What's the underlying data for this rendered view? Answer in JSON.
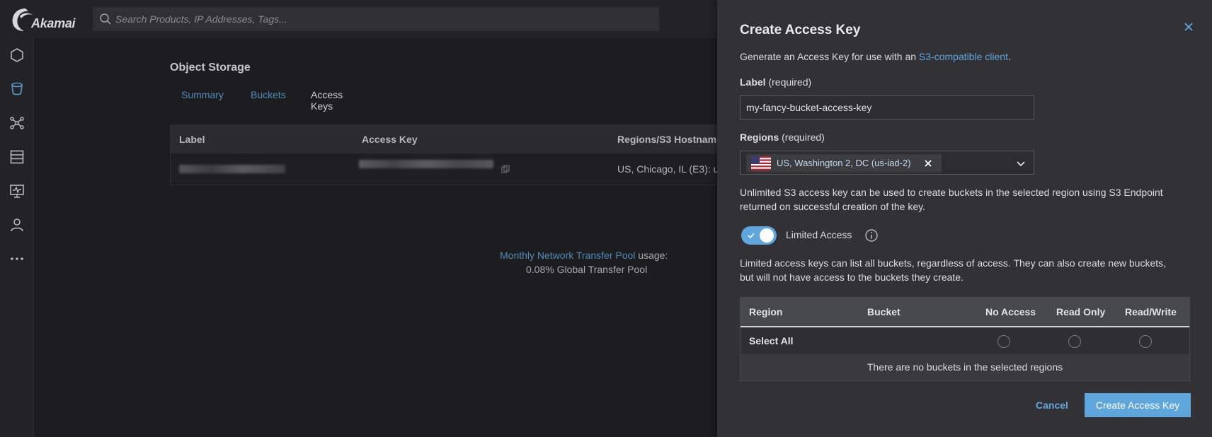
{
  "topbar": {
    "logo_text": "Akamai",
    "search_placeholder": "Search Products, IP Addresses, Tags..."
  },
  "sidebar": {
    "items": [
      "compute-icon",
      "object-storage-icon",
      "network-icon",
      "databases-icon",
      "monitor-icon",
      "account-icon",
      "more-icon"
    ]
  },
  "main": {
    "page_title": "Object Storage",
    "tabs": [
      {
        "label": "Summary"
      },
      {
        "label": "Buckets"
      },
      {
        "label": "Access Keys",
        "active": true
      }
    ],
    "table": {
      "headers": [
        "Label",
        "Access Key",
        "Regions/S3 Hostnam"
      ],
      "rows": [
        {
          "regions": "US, Chicago, IL (E3): u"
        }
      ]
    },
    "transfer": {
      "link": "Monthly Network Transfer Pool",
      "suffix": " usage:",
      "line2": "0.08% Global Transfer Pool"
    }
  },
  "drawer": {
    "title": "Create Access Key",
    "description_prefix": "Generate an Access Key for use with an ",
    "description_link": "S3-compatible client",
    "description_suffix": ".",
    "label_field": {
      "label": "Label",
      "hint": " (required)",
      "value": "my-fancy-bucket-access-key"
    },
    "regions_field": {
      "label": "Regions",
      "hint": " (required)",
      "selected_chip": "US, Washington 2, DC (us-iad-2)"
    },
    "unlimited_note_line1": "Unlimited S3 access key can be used to create buckets in the selected region using S3 Endpoint",
    "unlimited_note_line2": "returned on successful creation of the key.",
    "toggle": {
      "label": "Limited Access",
      "checked": true
    },
    "limited_note_line1": "Limited access keys can list all buckets, regardless of access. They can also create new buckets,",
    "limited_note_line2": "but will not have access to the buckets they create.",
    "permissions_table": {
      "headers": [
        "Region",
        "Bucket",
        "No Access",
        "Read Only",
        "Read/Write"
      ],
      "select_all_label": "Select All",
      "empty_message": "There are no buckets in the selected regions"
    },
    "buttons": {
      "cancel": "Cancel",
      "submit": "Create Access Key"
    }
  },
  "colors": {
    "accent": "#5fa6dd",
    "link": "#4d8ab8",
    "drawer_bg": "#323236",
    "page_bg": "#1d1d20"
  }
}
